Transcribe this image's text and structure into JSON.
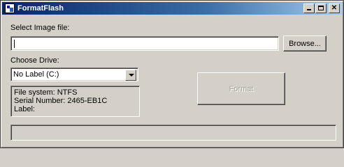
{
  "window": {
    "title": "FormatFlash",
    "controls": {
      "minimize": "_",
      "maximize": "□",
      "close": "✕"
    }
  },
  "image_file": {
    "label": "Select Image file:",
    "value": "",
    "browse_label": "Browse..."
  },
  "drive": {
    "label": "Choose Drive:",
    "selected": "No Label (C:)"
  },
  "info": {
    "file_system": "File system: NTFS",
    "serial": "Serial Number: 2465-EB1C",
    "label": "Label:"
  },
  "format_button": {
    "label": "Format",
    "enabled": false
  },
  "progress": {
    "value": 0
  },
  "icons": [
    "app-icon",
    "minimize-icon",
    "maximize-icon",
    "close-icon",
    "dropdown-arrow-icon"
  ]
}
